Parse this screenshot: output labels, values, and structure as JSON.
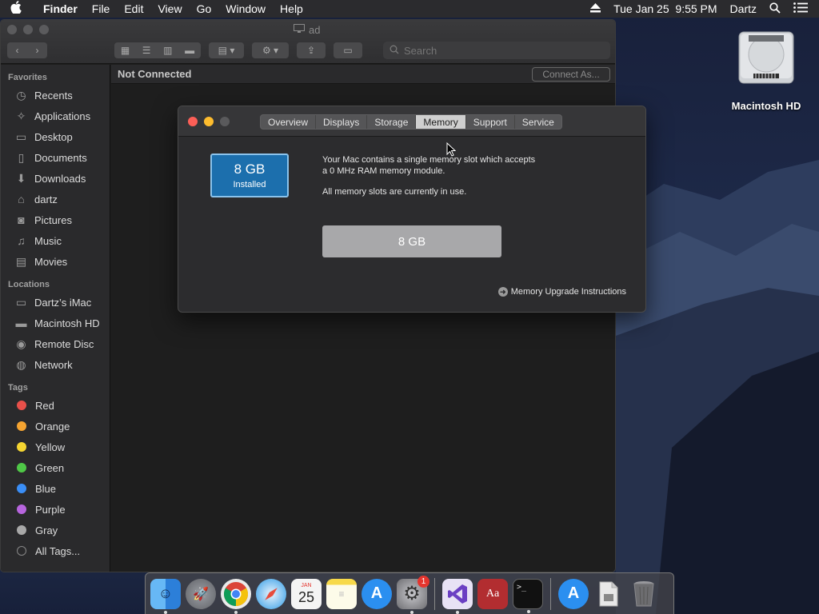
{
  "menubar": {
    "app_name": "Finder",
    "items": [
      "File",
      "Edit",
      "View",
      "Go",
      "Window",
      "Help"
    ],
    "datetime": "Tue Jan 25  9:55 PM",
    "user": "Dartz"
  },
  "desktop": {
    "disk_label": "Macintosh HD"
  },
  "finder": {
    "window_title": "ad",
    "search_placeholder": "Search",
    "status": "Not Connected",
    "connect_button": "Connect As...",
    "sidebar": {
      "favorites_header": "Favorites",
      "favorites": [
        {
          "label": "Recents",
          "icon": "clock-icon"
        },
        {
          "label": "Applications",
          "icon": "applications-icon"
        },
        {
          "label": "Desktop",
          "icon": "desktop-icon"
        },
        {
          "label": "Documents",
          "icon": "document-icon"
        },
        {
          "label": "Downloads",
          "icon": "download-icon"
        },
        {
          "label": "dartz",
          "icon": "home-icon"
        },
        {
          "label": "Pictures",
          "icon": "camera-icon"
        },
        {
          "label": "Music",
          "icon": "music-icon"
        },
        {
          "label": "Movies",
          "icon": "film-icon"
        }
      ],
      "locations_header": "Locations",
      "locations": [
        {
          "label": "Dartz’s iMac",
          "icon": "imac-icon"
        },
        {
          "label": "Macintosh HD",
          "icon": "disk-icon"
        },
        {
          "label": "Remote Disc",
          "icon": "disc-icon"
        },
        {
          "label": "Network",
          "icon": "globe-icon"
        }
      ],
      "tags_header": "Tags",
      "tags": [
        {
          "label": "Red",
          "color": "#e8504a"
        },
        {
          "label": "Orange",
          "color": "#f5a431"
        },
        {
          "label": "Yellow",
          "color": "#f5d531"
        },
        {
          "label": "Green",
          "color": "#4fc847"
        },
        {
          "label": "Blue",
          "color": "#3a8ef6"
        },
        {
          "label": "Purple",
          "color": "#b765de"
        },
        {
          "label": "Gray",
          "color": "#a8a8a8"
        }
      ],
      "all_tags": "All Tags..."
    }
  },
  "dialog": {
    "tabs": [
      "Overview",
      "Displays",
      "Storage",
      "Memory",
      "Support",
      "Service"
    ],
    "active_tab": "Memory",
    "memory_box_value": "8 GB",
    "memory_box_caption": "Installed",
    "description_line1": "Your Mac contains a single memory slot which accepts",
    "description_line2": "a 0 MHz RAM memory module.",
    "slots_status": "All memory slots are currently in use.",
    "slot_label": "8 GB",
    "upgrade_link": "Memory Upgrade Instructions"
  },
  "dock": {
    "apps": [
      {
        "name": "Finder",
        "icon": "finder-icon",
        "color": "#2f8ce5",
        "running": true
      },
      {
        "name": "Launchpad",
        "icon": "rocket-icon",
        "color": "#8b8d92",
        "running": false
      },
      {
        "name": "Google Chrome",
        "icon": "chrome-icon",
        "color": "#e9e9e9",
        "running": true
      },
      {
        "name": "Safari",
        "icon": "compass-icon",
        "color": "#2f9be6",
        "running": false
      },
      {
        "name": "Calendar",
        "icon": "calendar-icon",
        "color": "#f2f2f2",
        "running": false
      },
      {
        "name": "Notes",
        "icon": "notes-icon",
        "color": "#f7d94a",
        "running": false
      },
      {
        "name": "App Store",
        "icon": "appstore-icon",
        "color": "#2b8ff0",
        "running": false
      },
      {
        "name": "System Preferences",
        "icon": "gear-icon",
        "color": "#8e8e93",
        "running": true,
        "badge": "1"
      },
      {
        "name": "Visual Studio",
        "icon": "visualstudio-icon",
        "color": "#6b3fc3",
        "running": true
      },
      {
        "name": "Dictionary",
        "icon": "dictionary-icon",
        "color": "#b22d30",
        "running": false
      },
      {
        "name": "Terminal",
        "icon": "terminal-icon",
        "color": "#111111",
        "running": true
      },
      {
        "name": "App Store Downloads",
        "icon": "appstore-icon",
        "color": "#2b8ff0",
        "running": false
      },
      {
        "name": "Document",
        "icon": "file-icon",
        "color": "#dcdcdc",
        "running": false
      },
      {
        "name": "Trash",
        "icon": "trash-icon",
        "color": "#6d6d70",
        "running": false
      }
    ],
    "calendar_month": "JAN",
    "calendar_day": "25"
  }
}
